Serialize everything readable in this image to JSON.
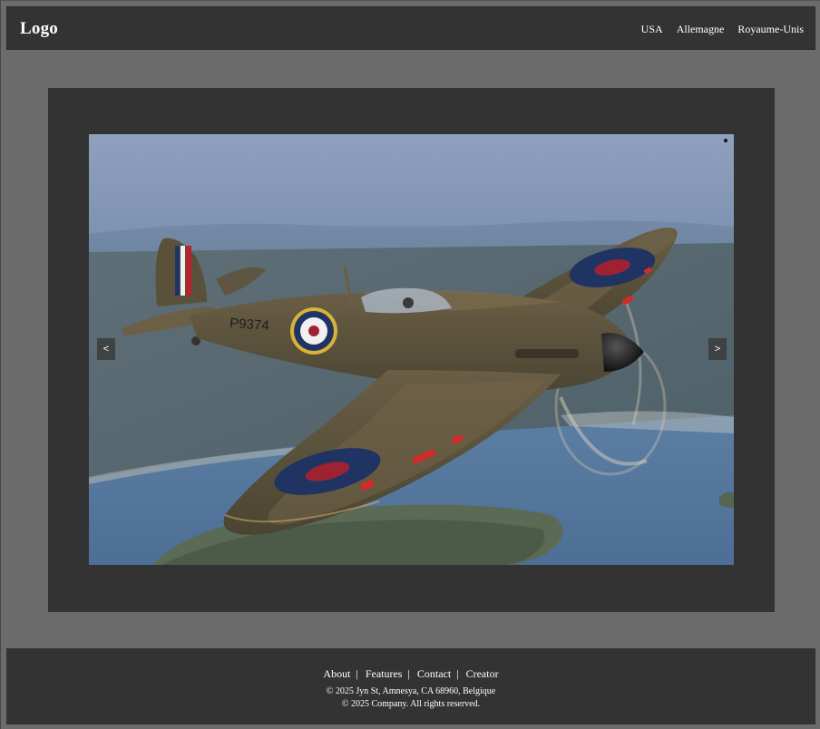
{
  "header": {
    "logo": "Logo",
    "nav": [
      {
        "label": "USA"
      },
      {
        "label": "Allemagne"
      },
      {
        "label": "Royaume-Unis"
      }
    ]
  },
  "carousel": {
    "prev_label": "<",
    "next_label": ">",
    "image": {
      "subject": "spitfire-aircraft-photo",
      "fuselage_code": "P9374"
    }
  },
  "footer": {
    "links": [
      {
        "label": "About"
      },
      {
        "label": "Features"
      },
      {
        "label": "Contact"
      },
      {
        "label": "Creator"
      }
    ],
    "separator": "|",
    "address": "© 2025 Jyn St, Amnesya, CA 68960, Belgique",
    "copyright": "© 2025 Company. All rights reserved."
  },
  "colors": {
    "page_background": "#6b6b6b",
    "panel_background": "#333333",
    "text": "#ffffff"
  }
}
